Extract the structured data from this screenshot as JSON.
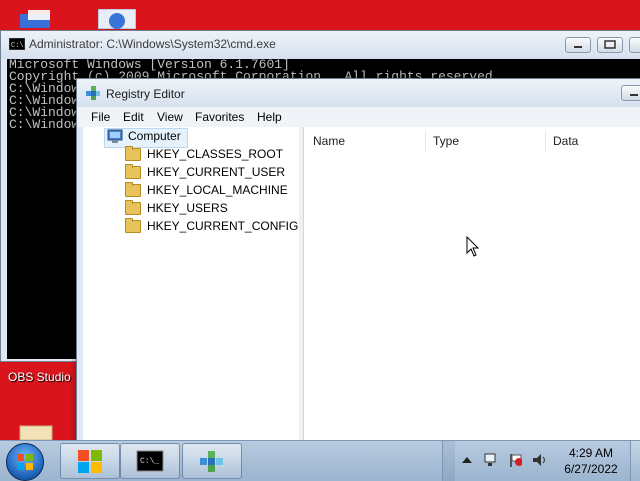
{
  "desktop": {
    "obs_label": "OBS Studio"
  },
  "cmd_window": {
    "title": "Administrator: C:\\Windows\\System32\\cmd.exe",
    "lines": [
      "Microsoft Windows [Version 6.1.7601]",
      "Copyright (c) 2009 Microsoft Corporation.  All rights reserved.",
      "",
      "C:\\Window",
      "",
      "C:\\Window",
      "C:\\Window",
      "",
      "C:\\Window"
    ]
  },
  "regedit": {
    "title": "Registry Editor",
    "menu": [
      "File",
      "Edit",
      "View",
      "Favorites",
      "Help"
    ],
    "tree": {
      "root": "Computer",
      "keys": [
        "HKEY_CLASSES_ROOT",
        "HKEY_CURRENT_USER",
        "HKEY_LOCAL_MACHINE",
        "HKEY_USERS",
        "HKEY_CURRENT_CONFIG"
      ]
    },
    "columns": [
      "Name",
      "Type",
      "Data"
    ]
  },
  "taskbar": {
    "time": "4:29 AM",
    "date": "6/27/2022"
  },
  "colors": {
    "desktop": "#d9141c",
    "titlebar": "#dfe8f3",
    "console_bg": "#000000",
    "console_fg": "#c0c0c0"
  },
  "icons": [
    "start-orb-icon",
    "explorer-icon",
    "cmd-icon",
    "regedit-icon",
    "arrow-up-icon",
    "network-icon",
    "flag-icon",
    "speaker-icon"
  ]
}
